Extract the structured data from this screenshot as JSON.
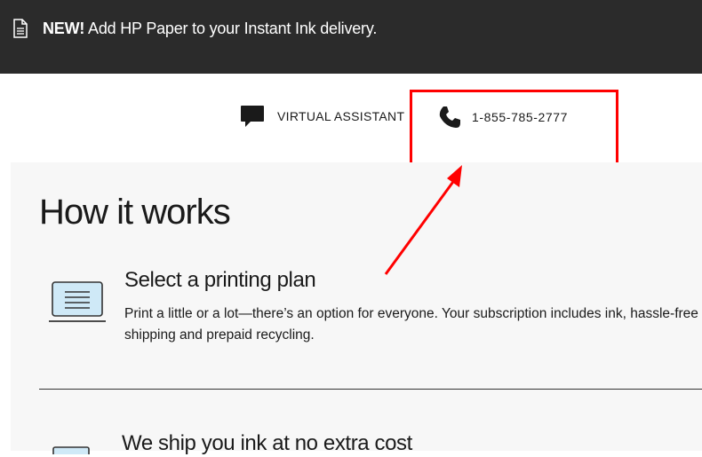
{
  "banner": {
    "icon": "document-icon",
    "highlight": "NEW!",
    "text": " Add HP Paper to your Instant Ink delivery."
  },
  "contact": {
    "virtual_assistant_label": "VIRTUAL ASSISTANT",
    "virtual_assistant_icon": "chat-bubble-icon",
    "phone_number": "1-855-785-2777",
    "phone_icon": "phone-icon"
  },
  "how_it_works": {
    "title": "How it works",
    "steps": [
      {
        "icon": "laptop-icon",
        "title": "Select a printing plan",
        "description": "Print a little or a lot—there’s an option for everyone. Your subscription includes ink, hassle-free shipping and prepaid recycling."
      },
      {
        "icon": "box-icon",
        "title": "We ship you ink at no extra cost"
      }
    ]
  },
  "annotation": {
    "highlight_color": "#ff0000"
  },
  "colors": {
    "banner_bg": "#2b2b2b",
    "panel_bg": "#f7f7f7",
    "laptop_screen": "#cfe9f7"
  }
}
